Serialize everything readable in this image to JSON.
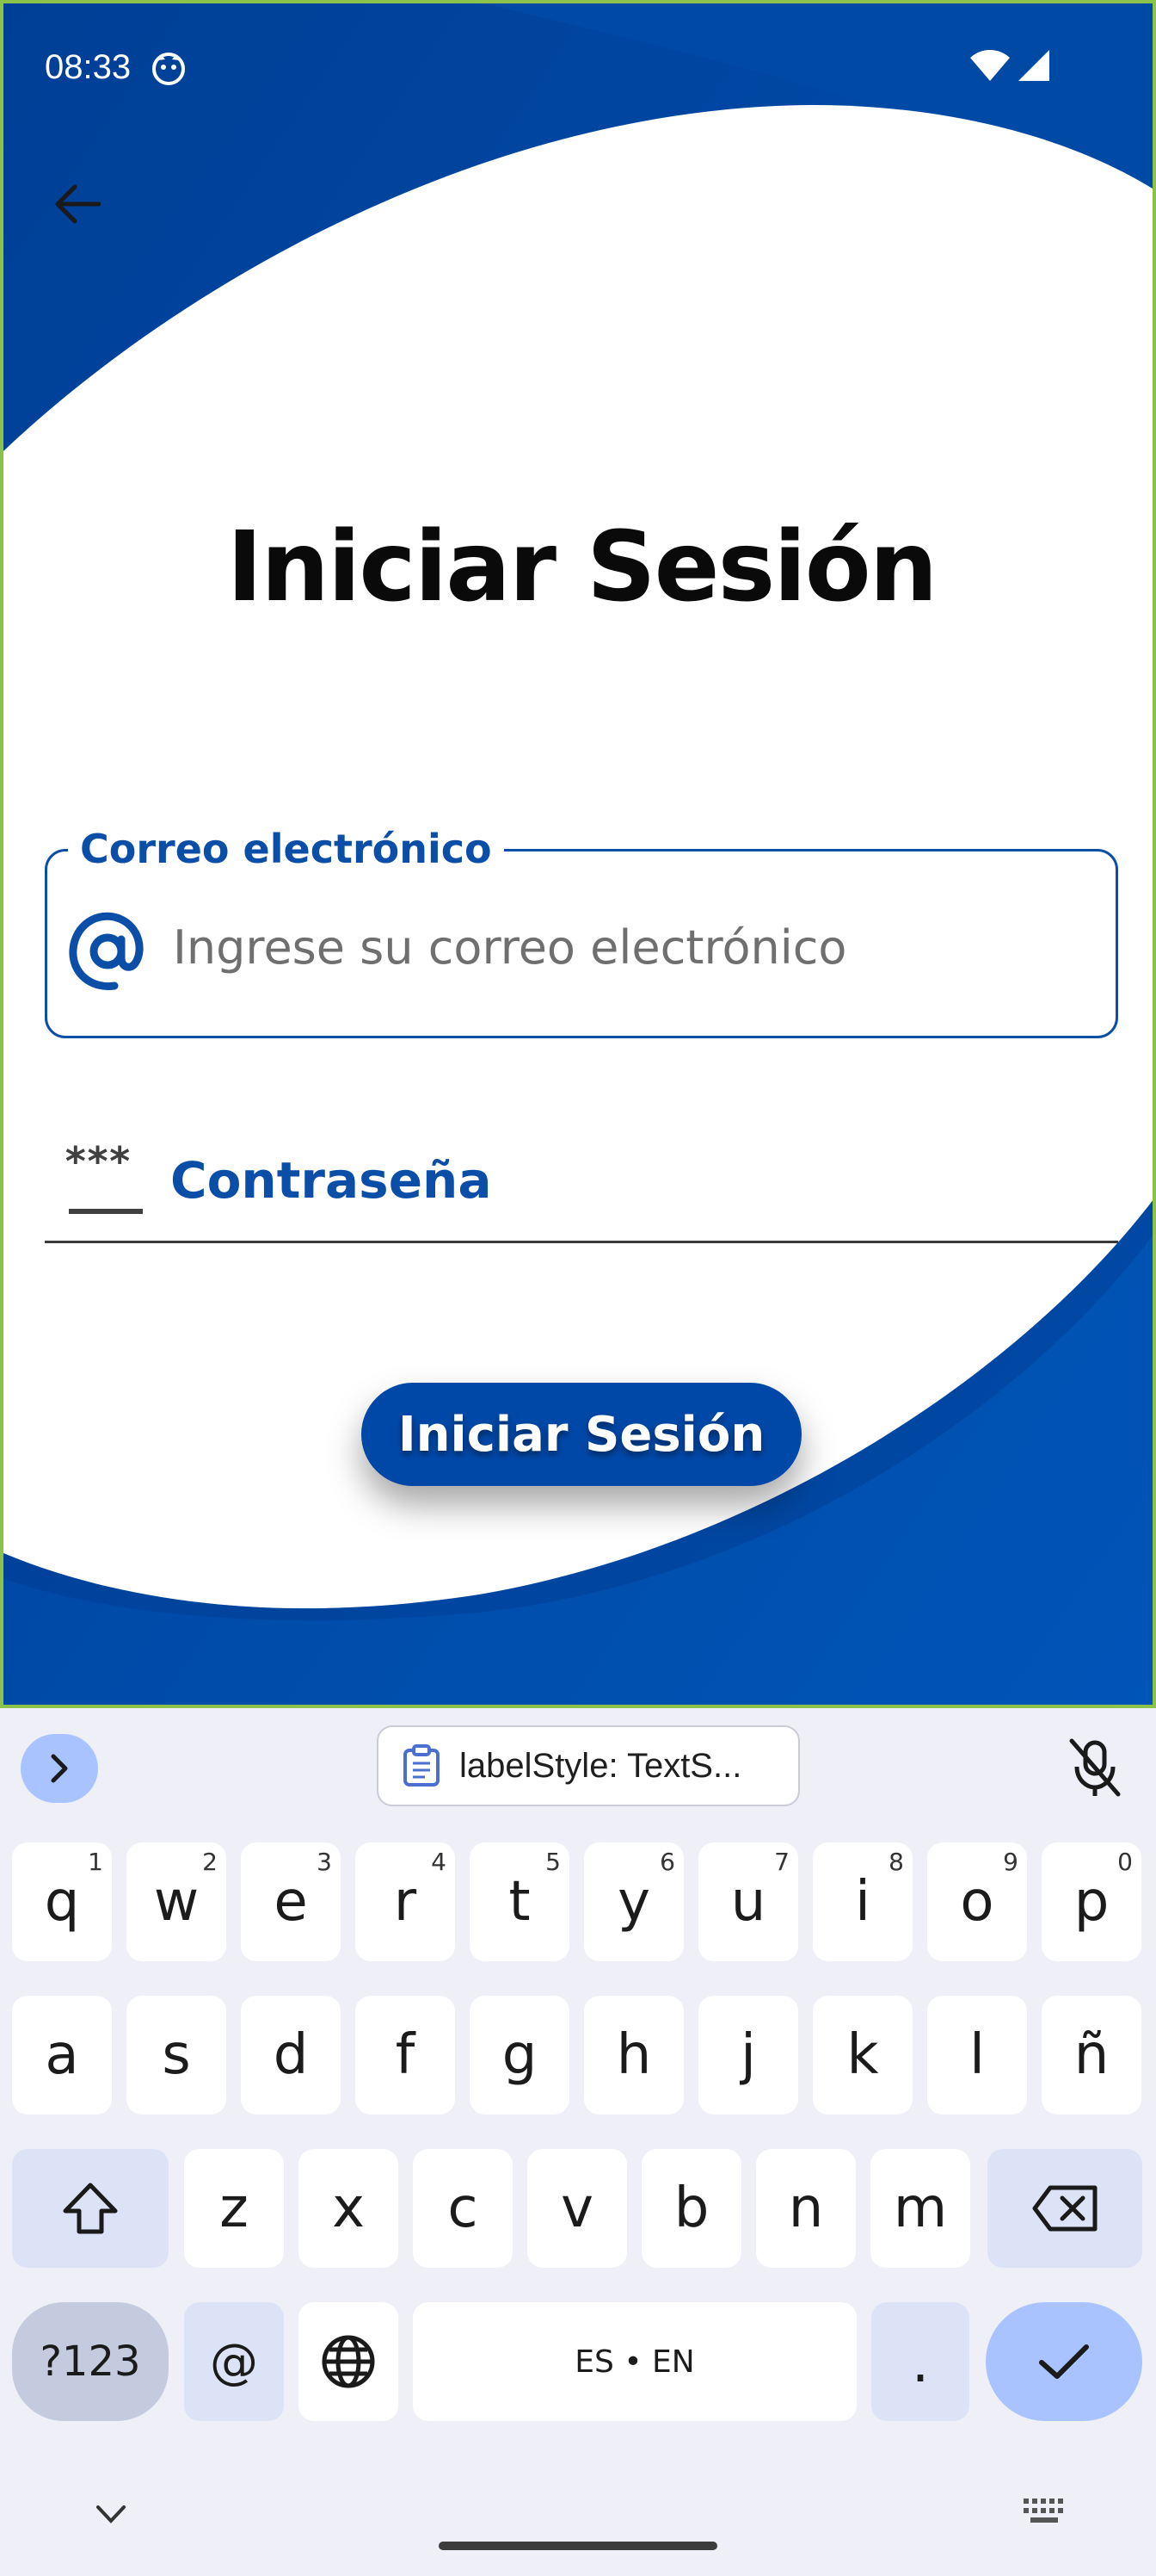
{
  "status_bar": {
    "time": "08:33"
  },
  "login": {
    "title": "Iniciar Sesión",
    "email_label": "Correo electrónico",
    "email_placeholder": "Ingrese su correo electrónico",
    "password_placeholder": "Contraseña",
    "password_icon_text": "***",
    "submit_label": "Iniciar Sesión"
  },
  "colors": {
    "brand_blue": "#0050b0",
    "accent_blue": "#0b4ea8",
    "background": "#ffffff"
  },
  "keyboard": {
    "clipboard_suggestion": "labelStyle: TextS...",
    "row1": [
      {
        "k": "q",
        "h": "1"
      },
      {
        "k": "w",
        "h": "2"
      },
      {
        "k": "e",
        "h": "3"
      },
      {
        "k": "r",
        "h": "4"
      },
      {
        "k": "t",
        "h": "5"
      },
      {
        "k": "y",
        "h": "6"
      },
      {
        "k": "u",
        "h": "7"
      },
      {
        "k": "i",
        "h": "8"
      },
      {
        "k": "o",
        "h": "9"
      },
      {
        "k": "p",
        "h": "0"
      }
    ],
    "row2": [
      "a",
      "s",
      "d",
      "f",
      "g",
      "h",
      "j",
      "k",
      "l",
      "ñ"
    ],
    "row3": [
      "z",
      "x",
      "c",
      "v",
      "b",
      "n",
      "m"
    ],
    "symbols_label": "?123",
    "at_label": "@",
    "space_label": "ES • EN",
    "period_label": "."
  }
}
